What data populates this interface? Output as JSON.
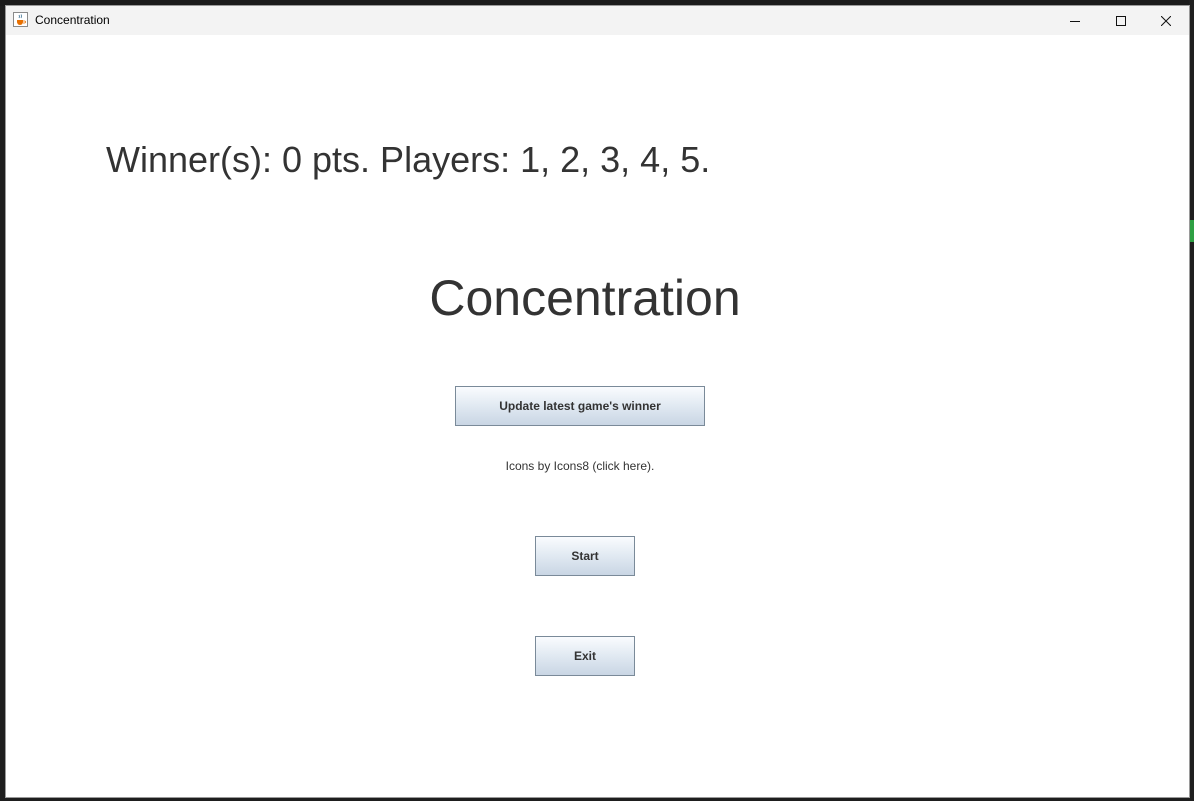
{
  "window": {
    "title": "Concentration",
    "app_icon": "java-cup-icon",
    "controls": [
      "minimize-icon",
      "maximize-icon",
      "close-icon"
    ]
  },
  "content": {
    "winner_text": "Winner(s): 0 pts. Players: 1, 2, 3, 4, 5.",
    "title": "Concentration",
    "update_button_label": "Update latest game's winner",
    "icons_credit": "Icons by Icons8 (click here).",
    "start_button_label": "Start",
    "exit_button_label": "Exit"
  },
  "colors": {
    "text": "#333333",
    "button_border": "#7a8a99",
    "button_gradient_top": "#fafcfe",
    "button_gradient_bottom": "#c9d6e4"
  }
}
